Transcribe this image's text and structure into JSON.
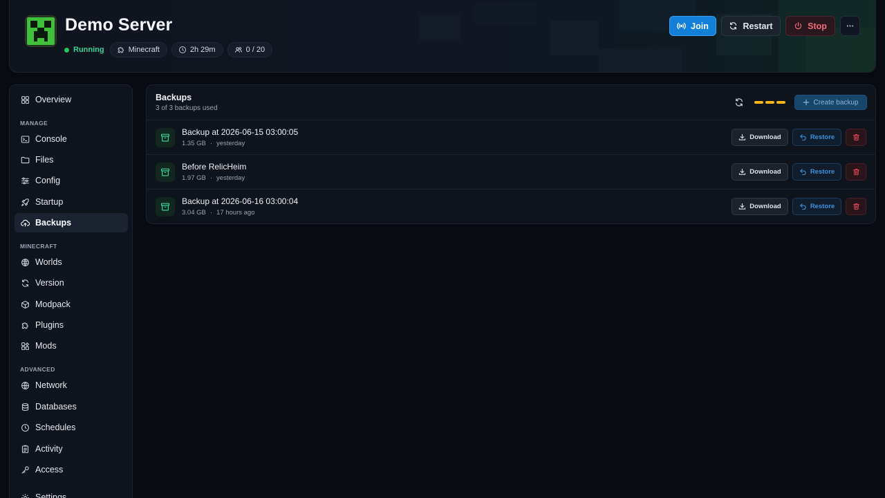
{
  "header": {
    "title": "Demo Server",
    "status": "Running",
    "chips": {
      "type": "Minecraft",
      "uptime": "2h 29m",
      "players": "0 / 20"
    },
    "buttons": {
      "join": "Join",
      "restart": "Restart",
      "stop": "Stop"
    },
    "icons": {
      "logo": "creeper-icon",
      "type": "puzzle-icon",
      "uptime": "clock-icon",
      "players": "users-icon",
      "join": "broadcast-icon",
      "restart": "refresh-icon",
      "stop": "power-icon",
      "more": "ellipsis-icon"
    }
  },
  "sidebar": {
    "overview": "Overview",
    "sections": {
      "manage": "MANAGE",
      "minecraft": "MINECRAFT",
      "advanced": "ADVANCED"
    },
    "items": {
      "console": "Console",
      "files": "Files",
      "config": "Config",
      "startup": "Startup",
      "backups": "Backups",
      "worlds": "Worlds",
      "version": "Version",
      "modpack": "Modpack",
      "plugins": "Plugins",
      "mods": "Mods",
      "network": "Network",
      "databases": "Databases",
      "schedules": "Schedules",
      "activity": "Activity",
      "access": "Access",
      "settings": "Settings"
    },
    "active": "backups"
  },
  "backups": {
    "title": "Backups",
    "subtitle": "3 of 3 backups used",
    "create_label": "Create backup",
    "download_label": "Download",
    "restore_label": "Restore",
    "items": [
      {
        "name": "Backup at 2026-06-15 03:00:05",
        "size": "1.35 GB",
        "when": "yesterday"
      },
      {
        "name": "Before RelicHeim",
        "size": "1.97 GB",
        "when": "yesterday"
      },
      {
        "name": "Backup at 2026-06-16 03:00:04",
        "size": "3.04 GB",
        "when": "17 hours ago"
      }
    ]
  },
  "colors": {
    "accent": "#1280d8",
    "running": "#22c55e",
    "danger": "#e0455a",
    "loader": "#f2b51d",
    "backup_icon": "#34d399"
  }
}
